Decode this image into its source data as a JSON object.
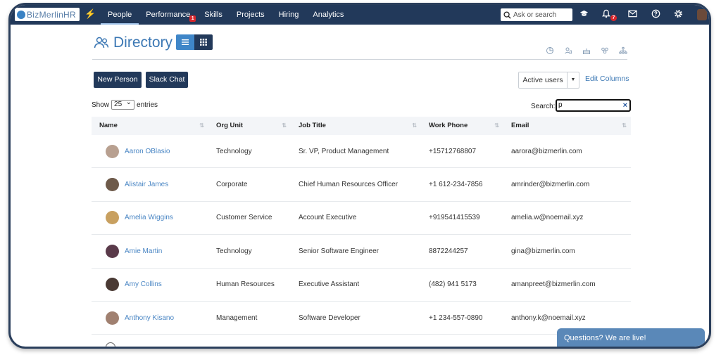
{
  "app": {
    "logo_text": "BizMerlinHR"
  },
  "nav": {
    "items": [
      {
        "label": "People",
        "active": true
      },
      {
        "label": "Performance",
        "badge": "1"
      },
      {
        "label": "Skills"
      },
      {
        "label": "Projects"
      },
      {
        "label": "Hiring"
      },
      {
        "label": "Analytics"
      }
    ]
  },
  "topbar": {
    "search_placeholder": "Ask or search",
    "notification_count": "7"
  },
  "page": {
    "title": "Directory"
  },
  "actions": {
    "new_person": "New Person",
    "slack_chat": "Slack Chat",
    "active_users": "Active users",
    "edit_columns": "Edit Columns"
  },
  "table_controls": {
    "show": "Show",
    "entries_value": "25",
    "entries": "entries",
    "search_label": "Search:",
    "search_value": "p",
    "clear": "×"
  },
  "table": {
    "columns": [
      "Name",
      "Org Unit",
      "Job Title",
      "Work Phone",
      "Email"
    ],
    "rows": [
      {
        "name": "Aaron OBlasio",
        "org": "Technology",
        "title": "Sr. VP, Product Management",
        "phone": "+15712768807",
        "email": "aarora@bizmerlin.com"
      },
      {
        "name": "Alistair James",
        "org": "Corporate",
        "title": "Chief Human Resources Officer",
        "phone": "+1 612-234-7856",
        "email": "amrinder@bizmerlin.com"
      },
      {
        "name": "Amelia Wiggins",
        "org": "Customer Service",
        "title": "Account Executive",
        "phone": "+919541415539",
        "email": "amelia.w@noemail.xyz"
      },
      {
        "name": "Amie Martin",
        "org": "Technology",
        "title": "Senior Software Engineer",
        "phone": "8872244257",
        "email": "gina@bizmerlin.com"
      },
      {
        "name": "Amy Collins",
        "org": "Human Resources",
        "title": "Executive Assistant",
        "phone": "(482) 941 5173",
        "email": "amanpreet@bizmerlin.com"
      },
      {
        "name": "Anthony Kisano",
        "org": "Management",
        "title": "Software Developer",
        "phone": "+1 234-557-0890",
        "email": "anthony.k@noemail.xyz"
      }
    ]
  },
  "chat": {
    "label": "Questions? We are live!"
  },
  "colors": {
    "navy": "#22395a",
    "accent": "#3c78b4",
    "badge_red": "#d9262c"
  }
}
